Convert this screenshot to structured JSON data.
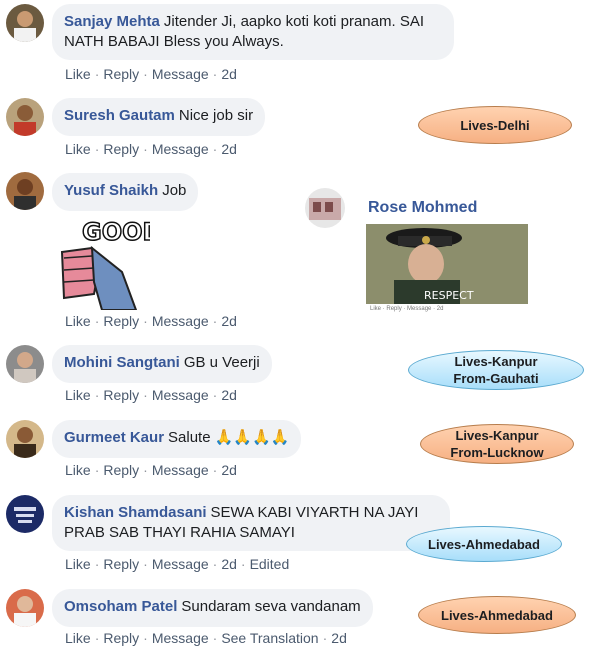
{
  "comments": [
    {
      "name": "Sanjay Mehta",
      "text": "Jitender Ji, aapko koti koti pranam. SAI NATH BABAJI Bless you Always.",
      "actions": [
        "Like",
        "Reply",
        "Message"
      ],
      "time": "2d"
    },
    {
      "name": "Suresh Gautam",
      "text": "Nice job sir",
      "actions": [
        "Like",
        "Reply",
        "Message"
      ],
      "time": "2d"
    },
    {
      "name": "Yusuf Shaikh",
      "text": "Job",
      "actions": [
        "Like",
        "Reply",
        "Message"
      ],
      "time": "2d"
    },
    {
      "name": "Mohini Sangtani",
      "text": "GB u Veerji",
      "actions": [
        "Like",
        "Reply",
        "Message"
      ],
      "time": "2d"
    },
    {
      "name": "Gurmeet Kaur",
      "text": "Salute 🙏🙏🙏🙏",
      "actions": [
        "Like",
        "Reply",
        "Message"
      ],
      "time": "2d"
    },
    {
      "name": "Kishan Shamdasani",
      "text": "SEWA KABI VIYARTH NA JAYI PRAB SAB THAYI RAHIA SAMAYI",
      "actions": [
        "Like",
        "Reply",
        "Message"
      ],
      "time": "2d",
      "extra": "Edited"
    },
    {
      "name": "Omsoham Patel",
      "text": "Sundaram seva vandanam",
      "actions": [
        "Like",
        "Reply",
        "Message",
        "See Translation"
      ],
      "time": "2d"
    }
  ],
  "inset": {
    "name": "Rose Mohmed",
    "image_text": "RESPECT",
    "actions": [
      "Like",
      "Reply",
      "Message"
    ],
    "time": "2d"
  },
  "sticker_text": "GOOD",
  "annotations": [
    {
      "line1": "Lives-Delhi",
      "line2": ""
    },
    {
      "line1": "Lives-Kanpur",
      "line2": "From-Gauhati"
    },
    {
      "line1": "Lives-Kanpur",
      "line2": "From-Lucknow"
    },
    {
      "line1": "Lives-Ahmedabad",
      "line2": ""
    },
    {
      "line1": "Lives-Ahmedabad",
      "line2": ""
    }
  ],
  "colors": {
    "name": "#385898",
    "bubble": "#f0f2f5",
    "orange_pill": "#f6b083",
    "blue_pill": "#a8defa"
  }
}
